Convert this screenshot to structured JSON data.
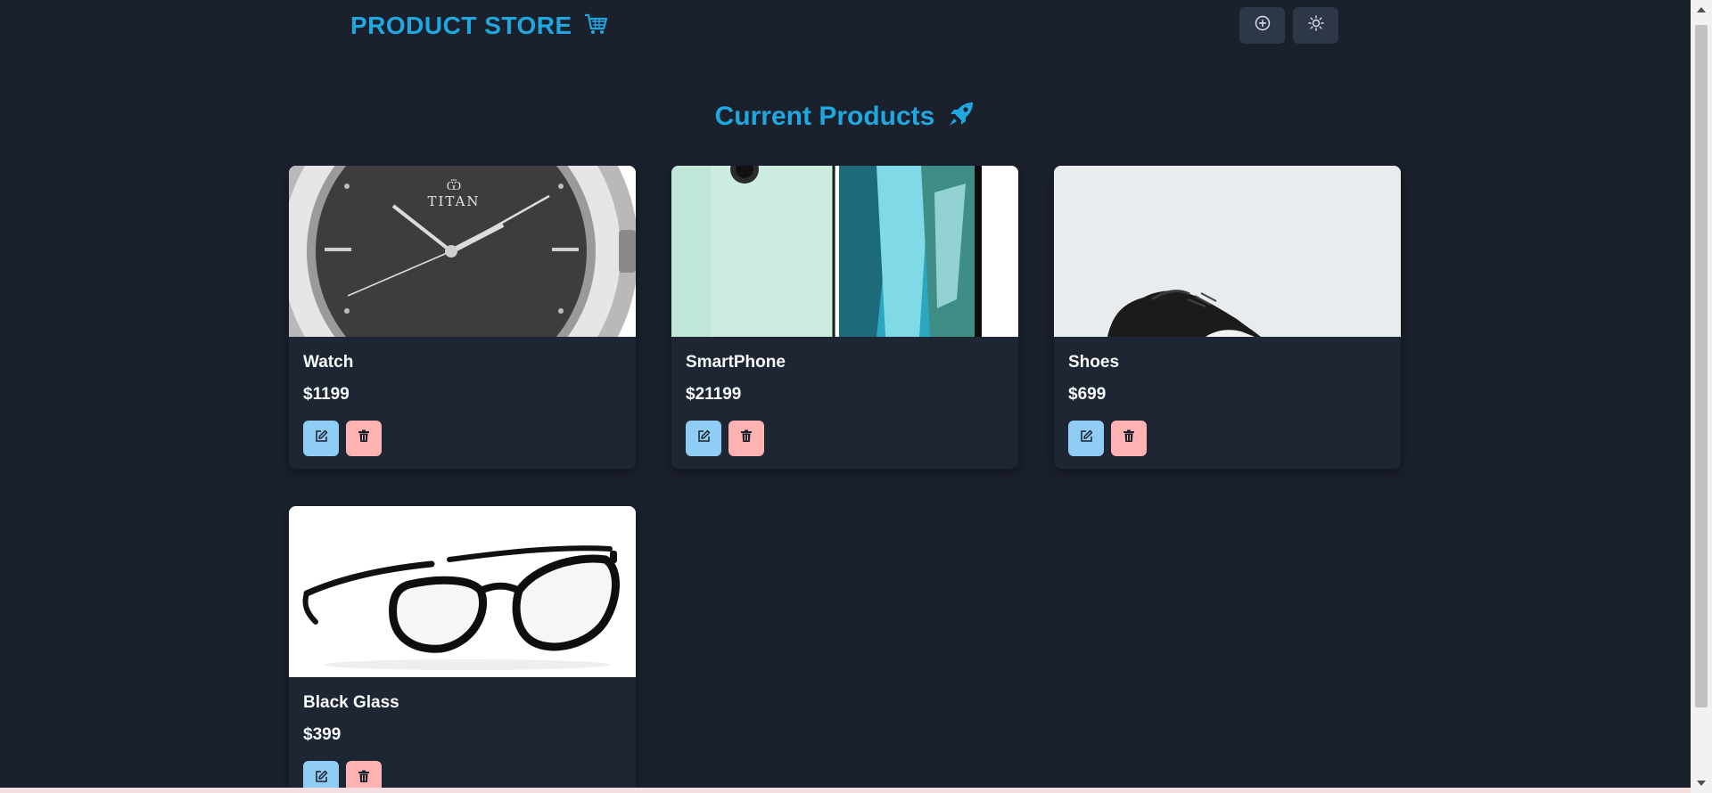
{
  "navbar": {
    "brand": "PRODUCT STORE",
    "brand_icon": "shopping-cart-icon",
    "add_button_icon": "plus-circle-icon",
    "theme_button_icon": "sun-icon"
  },
  "page": {
    "title": "Current Products",
    "title_icon": "rocket-icon"
  },
  "products": [
    {
      "name": "Watch",
      "price": "$1199",
      "image": "watch-image"
    },
    {
      "name": "SmartPhone",
      "price": "$21199",
      "image": "smartphone-image"
    },
    {
      "name": "Shoes",
      "price": "$699",
      "image": "shoes-image"
    },
    {
      "name": "Black Glass",
      "price": "$399",
      "image": "glasses-image"
    }
  ],
  "watch_brand_text": "TITAN",
  "colors": {
    "background": "#1a202c",
    "accent": "#1fa7e0",
    "edit_button": "#90cdf4",
    "delete_button": "#feb2b2",
    "card": "#1f2633"
  }
}
